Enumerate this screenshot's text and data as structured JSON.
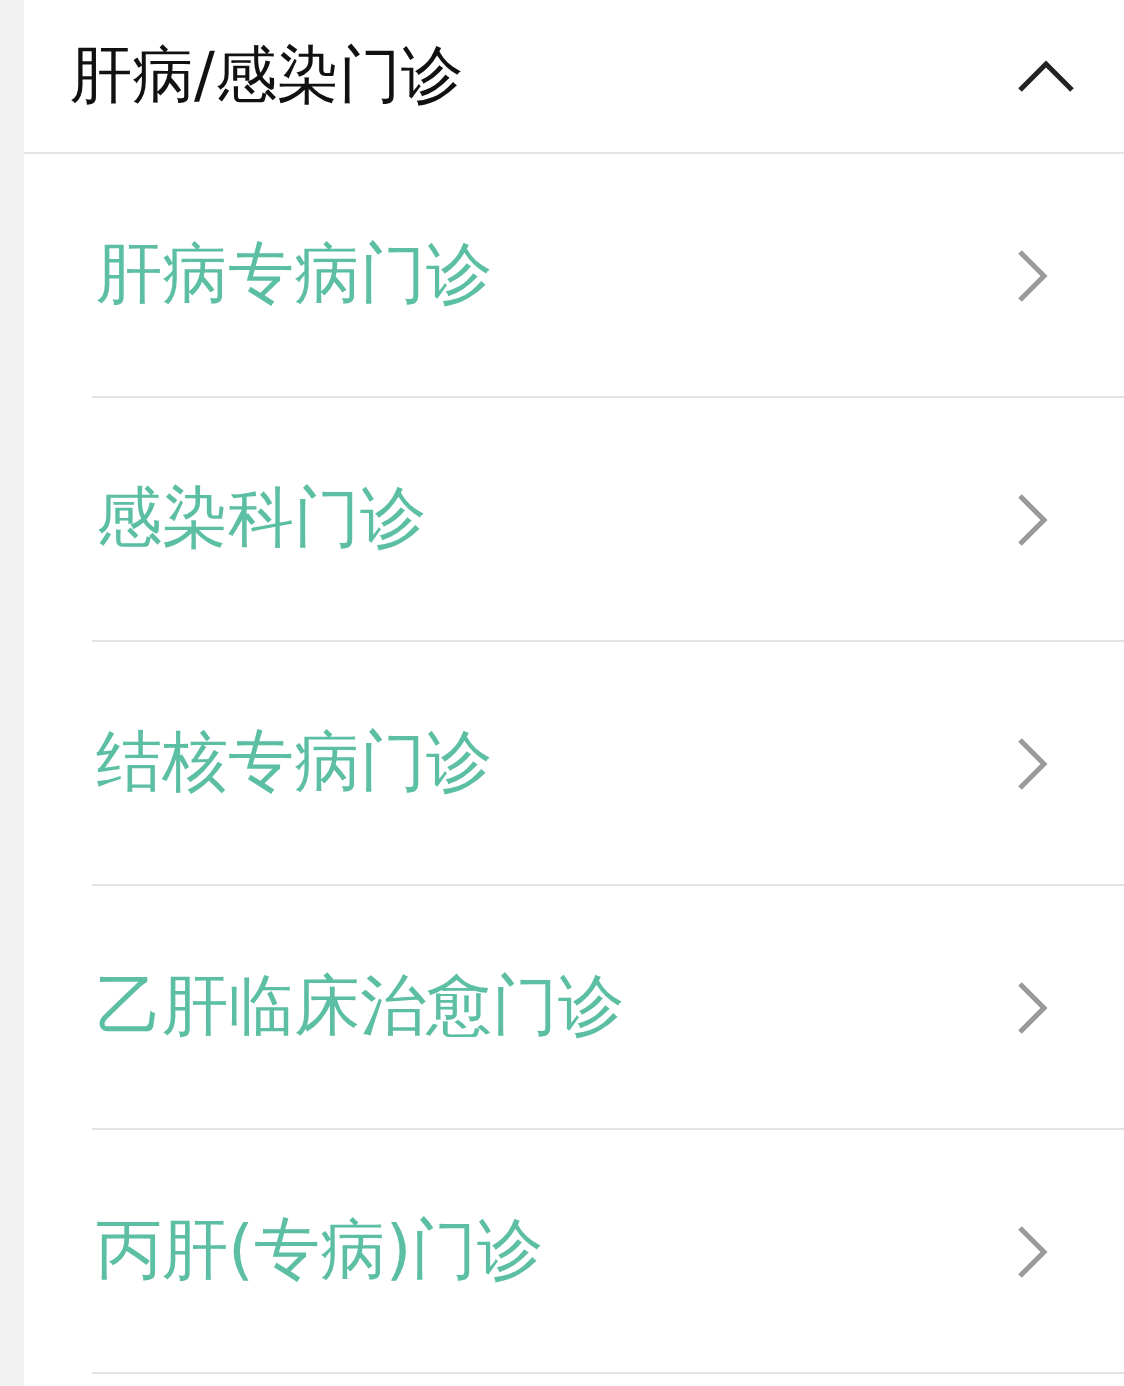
{
  "section": {
    "title": "肝病/感染门诊",
    "expanded": true
  },
  "items": [
    {
      "label": "肝病专病门诊"
    },
    {
      "label": "感染科门诊"
    },
    {
      "label": "结核专病门诊"
    },
    {
      "label": "乙肝临床治愈门诊"
    },
    {
      "label": "丙肝(专病)门诊"
    }
  ]
}
